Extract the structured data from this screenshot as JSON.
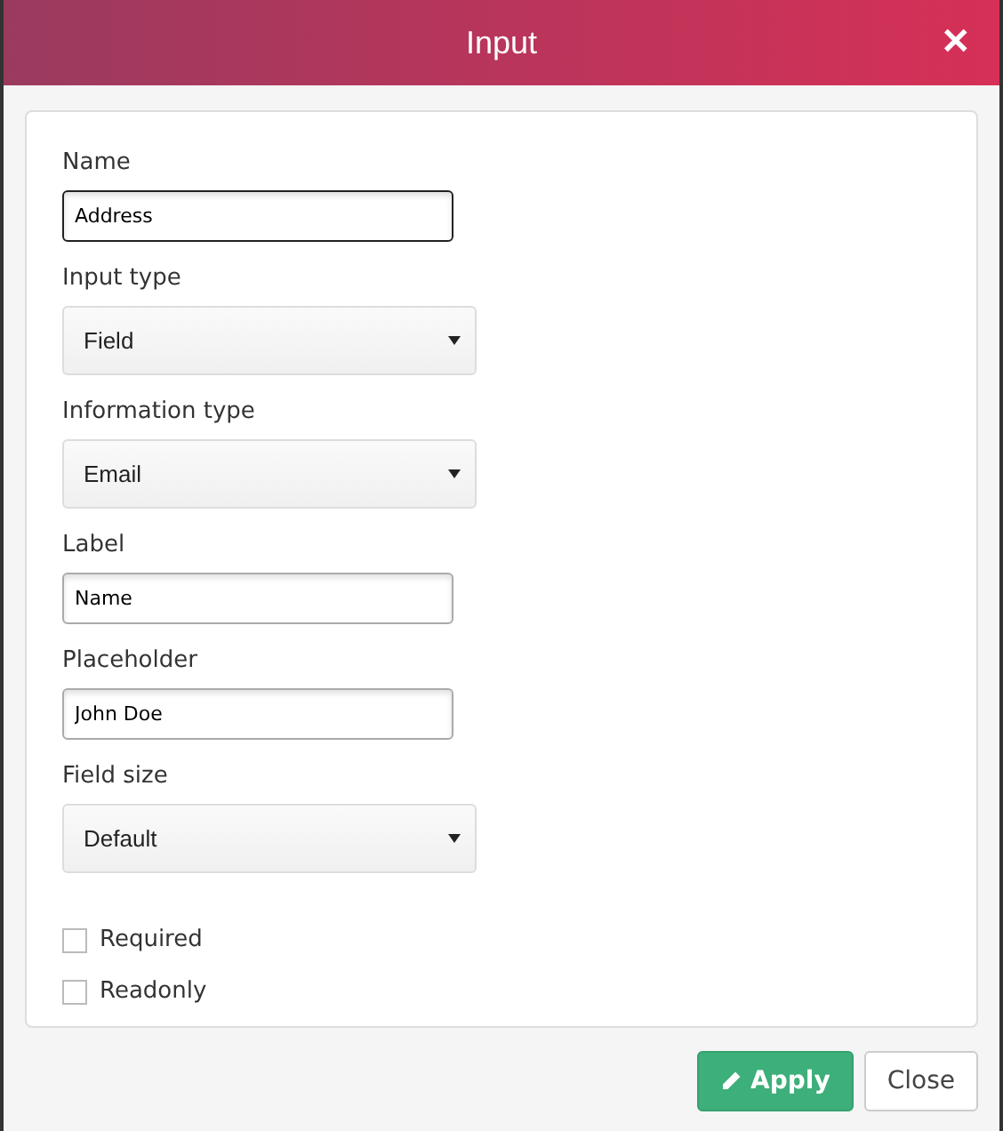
{
  "dialog": {
    "title": "Input",
    "close_icon": "✕"
  },
  "fields": [
    {
      "kind": "text",
      "label": "Name",
      "value": "Address",
      "focused": true
    },
    {
      "kind": "select",
      "label": "Input type",
      "value": "Field"
    },
    {
      "kind": "select",
      "label": "Information type",
      "value": "Email"
    },
    {
      "kind": "text",
      "label": "Label",
      "value": "Name",
      "focused": false
    },
    {
      "kind": "text",
      "label": "Placeholder",
      "value": "John Doe",
      "focused": false
    },
    {
      "kind": "select",
      "label": "Field size",
      "value": "Default"
    },
    {
      "kind": "checkbox",
      "label": "Required",
      "checked": false
    },
    {
      "kind": "checkbox",
      "label": "Readonly",
      "checked": false
    }
  ],
  "buttons": [
    {
      "kind": "primary",
      "label": "Apply"
    },
    {
      "kind": "default",
      "label": "Close"
    }
  ]
}
